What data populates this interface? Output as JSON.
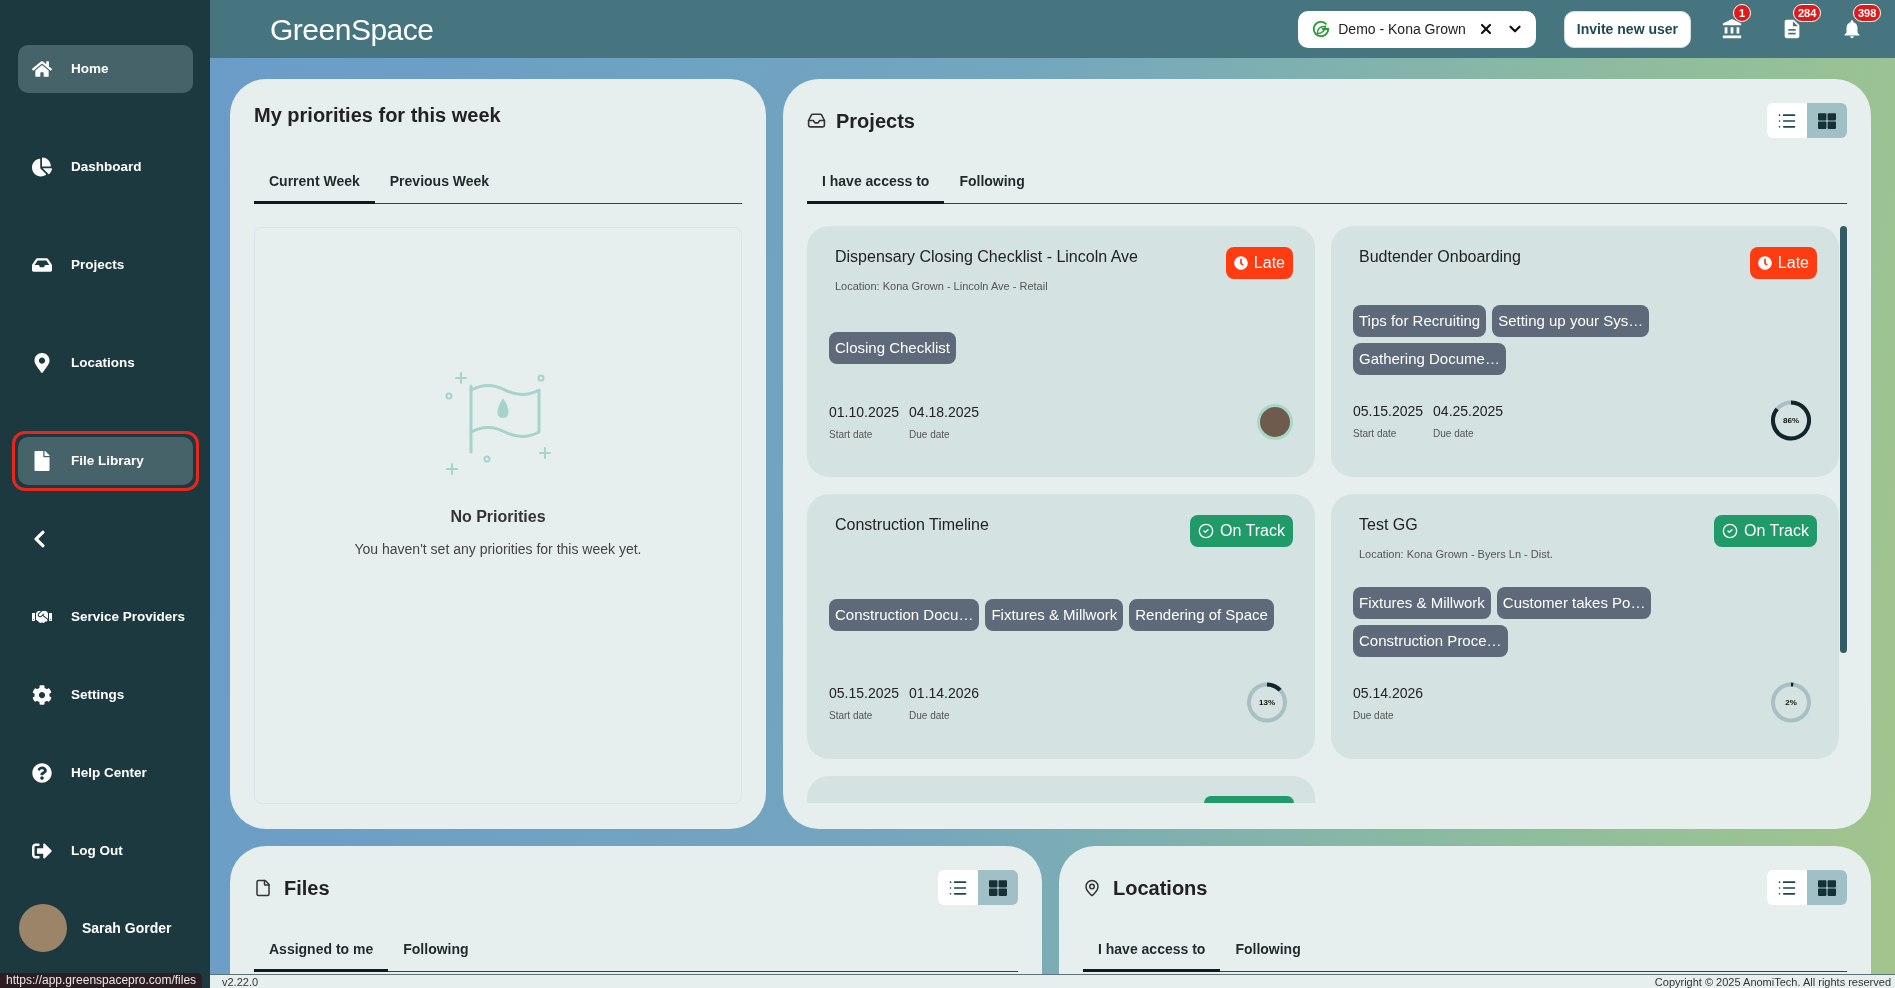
{
  "sidebar": {
    "nav_top": [
      {
        "label": "Home",
        "selected": true,
        "outlined": false
      },
      {
        "label": "Dashboard",
        "selected": false,
        "outlined": false
      },
      {
        "label": "Projects",
        "selected": false,
        "outlined": false
      },
      {
        "label": "Locations",
        "selected": false,
        "outlined": false
      },
      {
        "label": "File Library",
        "selected": true,
        "outlined": true
      }
    ],
    "nav_bottom": [
      {
        "label": "Service Providers",
        "selected": false
      },
      {
        "label": "Settings",
        "selected": false
      },
      {
        "label": "Help Center",
        "selected": false
      },
      {
        "label": "Log Out",
        "selected": false
      }
    ],
    "user": {
      "name": "Sarah Gorder"
    }
  },
  "header": {
    "logo": "GreenSpace",
    "organization": {
      "value": "Demo - Kona Grown"
    },
    "invite_button": "Invite new user",
    "notifications": [
      {
        "count": "1"
      },
      {
        "count": "284"
      },
      {
        "count": "398"
      }
    ]
  },
  "priorities": {
    "title": "My priorities for this week",
    "tabs": [
      {
        "label": "Current Week",
        "selected": true
      },
      {
        "label": "Previous Week",
        "selected": false
      }
    ],
    "empty_state": {
      "title": "No Priorities",
      "message": "You haven't set any priorities for this week yet."
    }
  },
  "projects": {
    "title": "Projects",
    "view_toggle": [
      {
        "kind": "list",
        "selected": false
      },
      {
        "kind": "grid",
        "selected": true
      }
    ],
    "tabs": [
      {
        "label": "I have access to",
        "selected": true
      },
      {
        "label": "Following",
        "selected": false
      }
    ],
    "cards": [
      {
        "title": "Dispensary Closing Checklist - Lincoln Ave",
        "location": "Location: Kona Grown - Lincoln Ave - Retail",
        "status": {
          "kind": "late",
          "label": "Late"
        },
        "tags": [
          "Closing Checklist"
        ],
        "dates": [
          {
            "value": "01.10.2025",
            "label": "Start date"
          },
          {
            "value": "04.18.2025",
            "label": "Due date"
          }
        ],
        "indicator": {
          "kind": "avatar"
        }
      },
      {
        "title": "Budtender Onboarding",
        "status": {
          "kind": "late",
          "label": "Late"
        },
        "tags": [
          "Tips for Recruiting",
          "Setting up your Sys…",
          "Gathering Docume…"
        ],
        "dates": [
          {
            "value": "05.15.2025",
            "label": "Start date"
          },
          {
            "value": "04.25.2025",
            "label": "Due date"
          }
        ],
        "indicator": {
          "kind": "progress",
          "level": 0.86,
          "reading": "86%"
        }
      },
      {
        "title": "Construction Timeline",
        "status": {
          "kind": "on_track",
          "label": "On Track"
        },
        "tags": [
          "Construction Docu…",
          "Fixtures & Millwork",
          "Rendering of Space"
        ],
        "dates": [
          {
            "value": "05.15.2025",
            "label": "Start date"
          },
          {
            "value": "01.14.2026",
            "label": "Due date"
          }
        ],
        "indicator": {
          "kind": "progress",
          "level": 0.13,
          "reading": "13%"
        }
      },
      {
        "title": "Test GG",
        "location": "Location: Kona Grown - Byers Ln - Dist.",
        "status": {
          "kind": "on_track",
          "label": "On Track"
        },
        "tags": [
          "Fixtures & Millwork",
          "Customer takes Po…",
          "Construction Proce…"
        ],
        "dates": [
          {
            "value": "05.14.2026",
            "label": "Due date"
          }
        ],
        "indicator": {
          "kind": "progress",
          "level": 0.02,
          "reading": "2%"
        }
      }
    ],
    "partial_card": {
      "status": {
        "kind": "on_track"
      }
    }
  },
  "files": {
    "title": "Files",
    "view_toggle": [
      {
        "kind": "list",
        "selected": false
      },
      {
        "kind": "grid",
        "selected": true
      }
    ],
    "tabs": [
      {
        "label": "Assigned to me",
        "selected": true
      },
      {
        "label": "Following",
        "selected": false
      }
    ]
  },
  "locations": {
    "title": "Locations",
    "view_toggle": [
      {
        "kind": "list",
        "selected": false
      },
      {
        "kind": "grid",
        "selected": true
      }
    ],
    "tabs": [
      {
        "label": "I have access to",
        "selected": true
      },
      {
        "label": "Following",
        "selected": false
      }
    ]
  },
  "status_bar": {
    "url": "https://app.greenspacepro.com/files",
    "version": "v2.22.0",
    "copyright": "Copyright © 2025 AnomiTech. All rights reserved"
  }
}
